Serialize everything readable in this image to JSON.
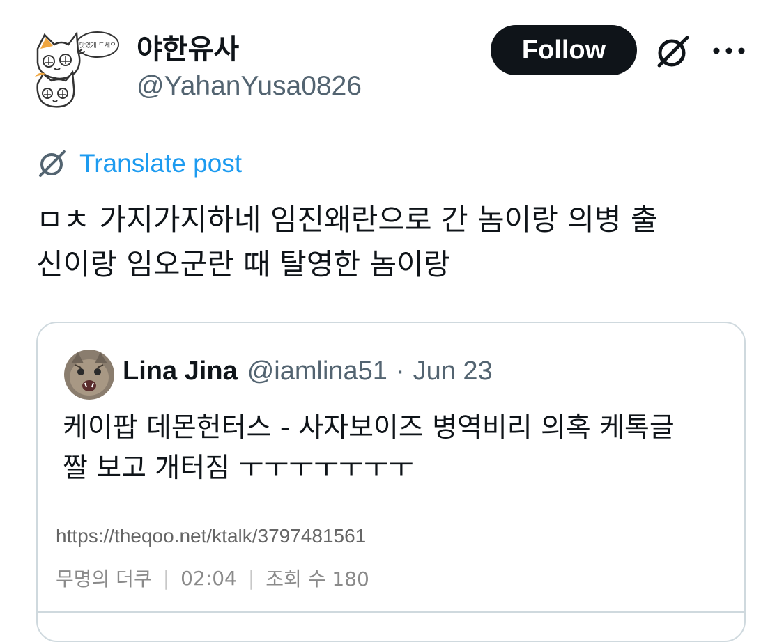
{
  "author": {
    "display_name": "야한유사",
    "handle": "@YahanYusa0826",
    "avatar_bubble_text": "맛있게 드세요"
  },
  "actions": {
    "follow_label": "Follow",
    "grok_icon": "grok-icon",
    "more_icon": "more-icon"
  },
  "translate": {
    "label": "Translate post"
  },
  "post": {
    "lines": [
      "ㅁㅊ 가지가지하네 임진왜란으로 간 놈이랑 의병 출",
      "신이랑 임오군란 때 탈영한 놈이랑"
    ]
  },
  "quote": {
    "name": "Lina Jina",
    "handle": "@iamlina51",
    "separator": "·",
    "date": "Jun 23",
    "lines": [
      "케이팝 데몬헌터스 - 사자보이즈 병역비리 의혹 케톡글",
      "짤 보고 개터짐 ㅜㅜㅜㅜㅜㅜㅜ"
    ],
    "embed": {
      "url": "https://theqoo.net/ktalk/3797481561",
      "author": "무명의 더쿠",
      "time": "02:04",
      "views": "조회 수 180"
    }
  },
  "colors": {
    "text": "#0f1419",
    "secondary": "#536471",
    "link": "#1d9bf0",
    "border": "#cfd9de"
  }
}
